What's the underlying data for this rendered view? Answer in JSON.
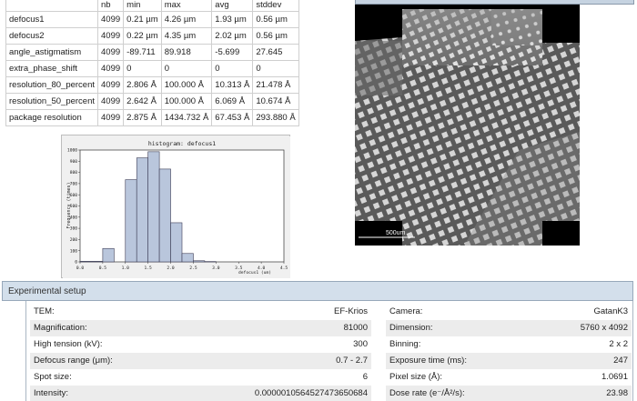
{
  "stats": {
    "headers": [
      "",
      "nb",
      "min",
      "max",
      "avg",
      "stddev"
    ],
    "rows": [
      [
        "defocus1",
        "4099",
        "0.21 µm",
        "4.26 µm",
        "1.93 µm",
        "0.56 µm"
      ],
      [
        "defocus2",
        "4099",
        "0.22 µm",
        "4.35 µm",
        "2.02 µm",
        "0.56 µm"
      ],
      [
        "angle_astigmatism",
        "4099",
        "-89.711",
        "89.918",
        "-5.699",
        "27.645"
      ],
      [
        "extra_phase_shift",
        "4099",
        "0",
        "0",
        "0",
        "0"
      ],
      [
        "resolution_80_percent",
        "4099",
        "2.806 Å",
        "100.000 Å",
        "10.313 Å",
        "21.478 Å"
      ],
      [
        "resolution_50_percent",
        "4099",
        "2.642 Å",
        "100.000 Å",
        "6.069 Å",
        "10.674 Å"
      ],
      [
        "package resolution",
        "4099",
        "2.875 Å",
        "1434.732 Å",
        "67.453 Å",
        "293.880 Å"
      ]
    ]
  },
  "chart_data": {
    "type": "bar",
    "title": "histogram: defocus1",
    "xlabel": "defocus1 (um)",
    "ylabel": "Frequency (times)",
    "xlim": [
      0.0,
      4.5
    ],
    "ylim": [
      0,
      1000
    ],
    "xticks": [
      "0.0",
      "0.5",
      "1.0",
      "1.5",
      "2.0",
      "2.5",
      "3.0",
      "3.5",
      "4.0",
      "4.5"
    ],
    "yticks": [
      "0",
      "100",
      "200",
      "300",
      "400",
      "500",
      "600",
      "700",
      "800",
      "900",
      "1000"
    ],
    "bins": [
      {
        "x0": 0.0,
        "x1": 0.5,
        "value": 5
      },
      {
        "x0": 0.5,
        "x1": 0.75,
        "value": 120
      },
      {
        "x0": 0.75,
        "x1": 1.0,
        "value": 0
      },
      {
        "x0": 1.0,
        "x1": 1.25,
        "value": 735
      },
      {
        "x0": 1.25,
        "x1": 1.5,
        "value": 930
      },
      {
        "x0": 1.5,
        "x1": 1.75,
        "value": 985
      },
      {
        "x0": 1.75,
        "x1": 2.0,
        "value": 830
      },
      {
        "x0": 2.0,
        "x1": 2.25,
        "value": 350
      },
      {
        "x0": 2.25,
        "x1": 2.5,
        "value": 75
      },
      {
        "x0": 2.5,
        "x1": 2.75,
        "value": 10
      },
      {
        "x0": 2.75,
        "x1": 3.0,
        "value": 3
      }
    ],
    "grid": false
  },
  "micrograph": {
    "scale_bar_label": "500um"
  },
  "setup": {
    "title": "Experimental setup",
    "left": [
      {
        "label": "TEM:",
        "value": "EF-Krios"
      },
      {
        "label": "Magnification:",
        "value": "81000"
      },
      {
        "label": "High tension (kV):",
        "value": "300"
      },
      {
        "label": "Defocus range (μm):",
        "value": "0.7 - 2.7"
      },
      {
        "label": "Spot size:",
        "value": "6"
      },
      {
        "label": "Intensity:",
        "value": "0.000001056452747365068​4"
      }
    ],
    "right": [
      {
        "label": "Camera:",
        "value": "GatanK3"
      },
      {
        "label": "Dimension:",
        "value": "5760 x 4092"
      },
      {
        "label": "Binning:",
        "value": "2 x 2"
      },
      {
        "label": "Exposure time (ms):",
        "value": "247"
      },
      {
        "label": "Pixel size (Å):",
        "value": "1.0691"
      },
      {
        "label": "Dose rate (e⁻/Å²/s):",
        "value": "23.98"
      }
    ]
  }
}
